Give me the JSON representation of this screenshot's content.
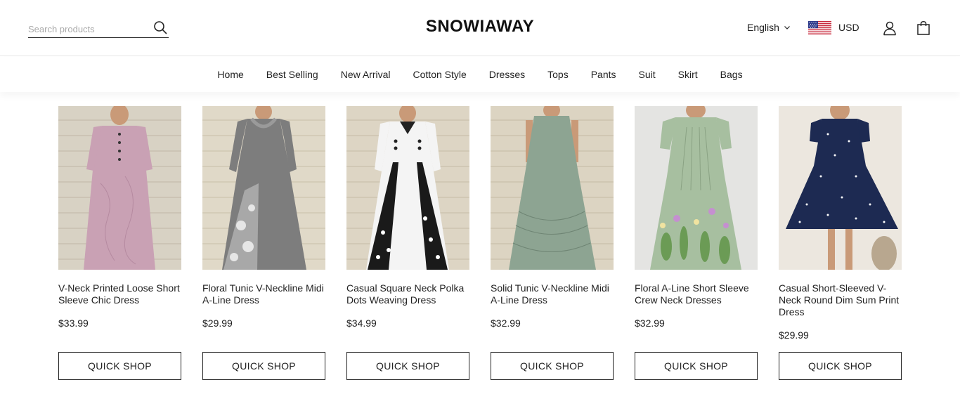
{
  "header": {
    "search_placeholder": "Search products",
    "logo": "SNOWIAWAY",
    "language": "English",
    "currency": "USD"
  },
  "nav": [
    "Home",
    "Best Selling",
    "New Arrival",
    "Cotton Style",
    "Dresses",
    "Tops",
    "Pants",
    "Suit",
    "Skirt",
    "Bags"
  ],
  "products": [
    {
      "name": "V-Neck Printed Loose Short Sleeve Chic Dress",
      "price": "$33.99",
      "button": "QUICK SHOP",
      "color": "#c9a1b4"
    },
    {
      "name": "Floral Tunic V-Neckline Midi A-Line Dress",
      "price": "$29.99",
      "button": "QUICK SHOP",
      "color": "#7d7d7d"
    },
    {
      "name": "Casual Square Neck Polka Dots Weaving Dress",
      "price": "$34.99",
      "button": "QUICK SHOP",
      "color": "#f2f2f2"
    },
    {
      "name": "Solid Tunic V-Neckline Midi A-Line Dress",
      "price": "$32.99",
      "button": "QUICK SHOP",
      "color": "#8da492"
    },
    {
      "name": "Floral A-Line Short Sleeve Crew Neck Dresses",
      "price": "$32.99",
      "button": "QUICK SHOP",
      "color": "#a7bfa0"
    },
    {
      "name": "Casual Short-Sleeved V-Neck Round Dim Sum Print Dress",
      "price": "$29.99",
      "button": "QUICK SHOP",
      "color": "#1d2a52"
    }
  ],
  "colors": {
    "text": "#222222",
    "border": "#222222",
    "background": "#ffffff"
  }
}
